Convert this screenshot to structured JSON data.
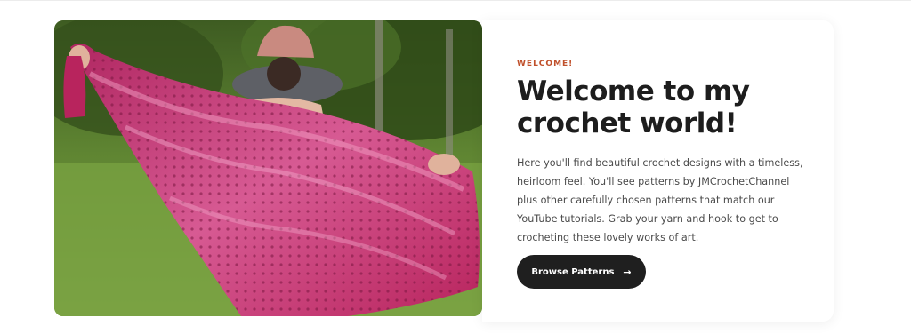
{
  "hero": {
    "image_alt": "Person holding up a pink crocheted lace shawl outdoors"
  },
  "card": {
    "eyebrow": "WELCOME!",
    "headline_line1": "Welcome to my",
    "headline_line2": "crochet world!",
    "intro": "Here you'll find beautiful crochet designs with a timeless, heirloom feel. You'll see patterns by JMCrochetChannel plus other carefully chosen patterns that match our YouTube tutorials. Grab your yarn and hook to get to crocheting these lovely works of art.",
    "cta_label": "Browse Patterns",
    "cta_icon": "arrow-right-icon"
  },
  "colors": {
    "accent": "#c0502b",
    "heading": "#1d1d1d",
    "button_bg": "#1f1f1f",
    "button_text": "#ffffff",
    "shawl": "#c2346e"
  }
}
